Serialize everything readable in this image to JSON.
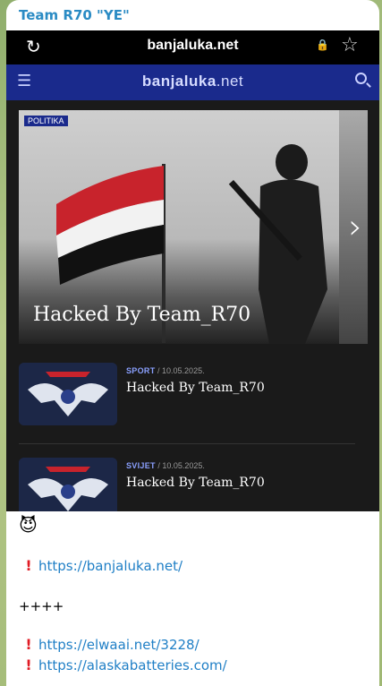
{
  "message": {
    "sender": "Team R70 \"YE\""
  },
  "browser": {
    "url": "banjaluka.net",
    "reload_icon": "reload-icon",
    "lock_icon": "lock-icon",
    "star_icon": "star-icon"
  },
  "site": {
    "logo_main": "banjaluka",
    "logo_suffix": ".net",
    "accent_color": "#1a2a8c"
  },
  "hero": {
    "tag": "POLITIKA",
    "headline": "Hacked By Team_R70"
  },
  "articles": [
    {
      "category": "SPORT",
      "date": "/ 10.05.2025.",
      "title": "Hacked By Team_R70"
    },
    {
      "category": "SVIJET",
      "date": "/ 10.05.2025.",
      "title": "Hacked By Team_R70"
    }
  ],
  "caption": {
    "emoji": "😈",
    "link1": "https://banjaluka.net/",
    "separator": "++++",
    "link2": "https://elwaai.net/3228/",
    "link3": "https://alaskabatteries.com/"
  }
}
